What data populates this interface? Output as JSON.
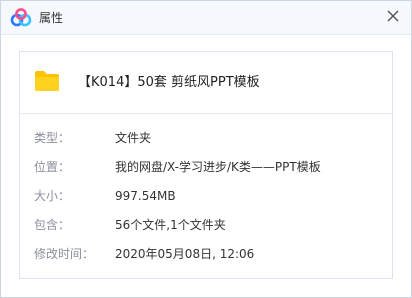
{
  "window": {
    "title": "属性",
    "close_icon": "close-icon",
    "app_icon": "baidu-netdisk-logo"
  },
  "file": {
    "icon": "folder-icon",
    "icon_color": "#fcc400",
    "name": "【K014】50套 剪纸风PPT模板"
  },
  "properties": [
    {
      "label": "类型：",
      "value": "文件夹"
    },
    {
      "label": "位置：",
      "value": "我的网盘/X-学习进步/K类——PPT模板"
    },
    {
      "label": "大小：",
      "value": "997.54MB"
    },
    {
      "label": "包含：",
      "value": "56个文件,1个文件夹"
    },
    {
      "label": "修改时间：",
      "value": "2020年05月08日, 12:06"
    }
  ],
  "colors": {
    "logo_blue": "#2a78ff",
    "logo_cyan": "#3ac3ff",
    "logo_pink": "#ff4f8b",
    "label_gray": "#8a8f99"
  }
}
